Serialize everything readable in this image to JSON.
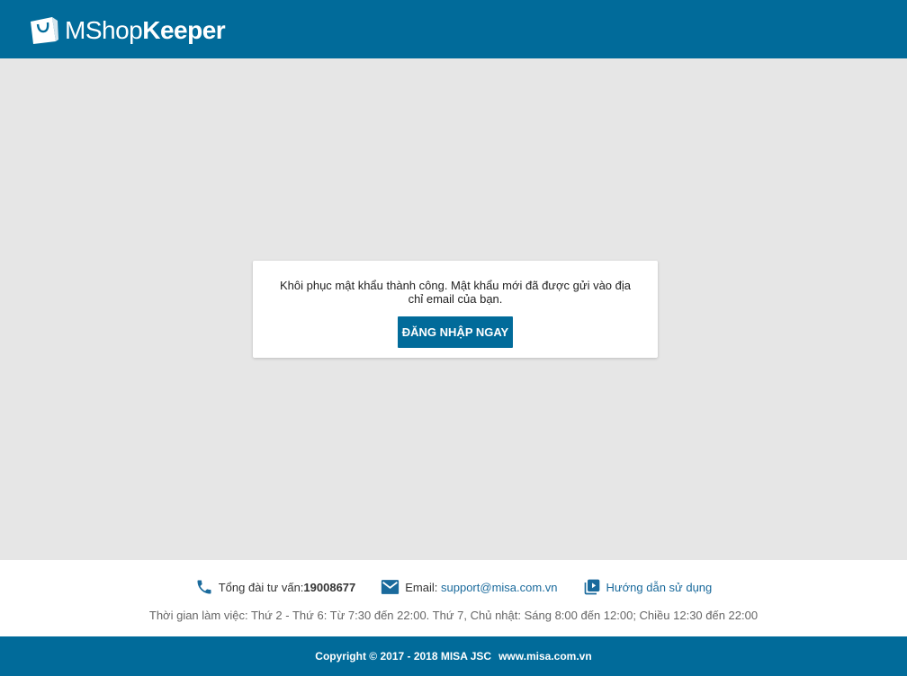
{
  "header": {
    "logo_thin": "MShop",
    "logo_bold": "Keeper"
  },
  "card": {
    "message": "Khôi phục mật khẩu thành công. Mật khẩu mới đã được gửi vào địa chỉ email của bạn.",
    "login_button": "ĐĂNG NHẬP NGAY"
  },
  "footer": {
    "hotline_label": "Tổng đài tư vấn:",
    "hotline_number": "19008677",
    "email_label": "Email: ",
    "email": "support@misa.com.vn",
    "guide_label": "Hướng dẫn sử dụng",
    "hours": "Thời gian làm việc: Thứ 2 - Thứ 6: Từ 7:30 đến 22:00. Thứ 7, Chủ nhật: Sáng 8:00 đến 12:00; Chiều 12:30 đến 22:00",
    "copyright": "Copyright © 2017 - 2018 MISA JSC",
    "website": "www.misa.com.vn"
  },
  "icons": {
    "logo": "shopping-bag-icon",
    "phone": "phone-icon",
    "email": "envelope-icon",
    "guide": "video-library-icon"
  },
  "colors": {
    "brand": "#016b9a",
    "background": "#e6e6e6",
    "link": "#1a6a9c"
  }
}
